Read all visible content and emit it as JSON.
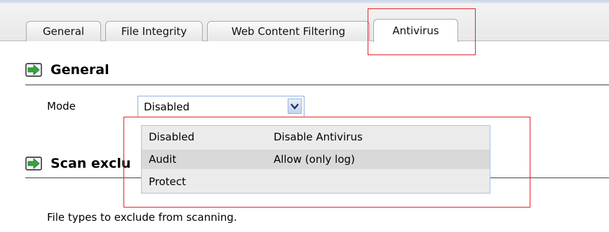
{
  "tabs": [
    {
      "label": "General",
      "active": false
    },
    {
      "label": "File Integrity",
      "active": false
    },
    {
      "label": "Web Content Filtering",
      "active": false
    },
    {
      "label": "Antivirus",
      "active": true
    }
  ],
  "sections": {
    "general_title": "General",
    "scan_title": "Scan exclu"
  },
  "mode": {
    "label": "Mode",
    "selected": "Disabled",
    "options": [
      {
        "value": "Disabled",
        "description": "Disable Antivirus"
      },
      {
        "value": "Audit",
        "description": "Allow (only log)"
      },
      {
        "value": "Protect",
        "description": ""
      }
    ]
  },
  "scan_note": "File types to exclude from scanning.",
  "colors": {
    "highlight_box": "#e2232b",
    "select_border": "#8fb2df",
    "section_icon": "#3aa33a"
  }
}
